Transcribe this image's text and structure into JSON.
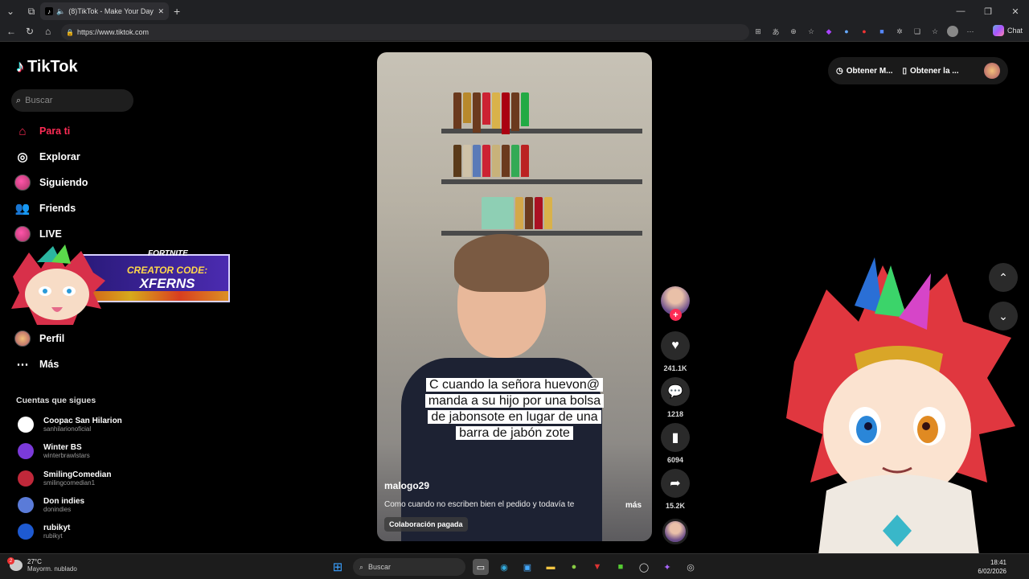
{
  "browser": {
    "tab_title": "(8)TikTok - Make Your Day",
    "url": "https://www.tiktok.com",
    "chat_label": "Chat"
  },
  "tiktok": {
    "logo": "TikTok",
    "search_placeholder": "Buscar",
    "menu": [
      {
        "label": "Para ti",
        "icon": "home-icon",
        "active": true
      },
      {
        "label": "Explorar",
        "icon": "compass-icon"
      },
      {
        "label": "Siguiendo",
        "icon": "following-avatar-icon"
      },
      {
        "label": "Friends",
        "icon": "friends-icon"
      },
      {
        "label": "LIVE",
        "icon": "live-avatar-icon"
      },
      {
        "label": "Perfil",
        "icon": "profile-avatar-icon"
      },
      {
        "label": "Más",
        "icon": "more-icon"
      }
    ],
    "following_title": "Cuentas que sigues",
    "following": [
      {
        "name": "Coopac San Hilarion",
        "handle": "sanhilarionoficial",
        "color": "#ffffff"
      },
      {
        "name": "Winter BS",
        "handle": "winterbrawlstars",
        "color": "#7b3ad9"
      },
      {
        "name": "SmilingComedian",
        "handle": "smilingcomedian1",
        "color": "#c0283a"
      },
      {
        "name": "Don indies",
        "handle": "donindies",
        "color": "#5a7bd8"
      },
      {
        "name": "rubikyt",
        "handle": "rubikyt",
        "color": "#1e5ad1"
      }
    ]
  },
  "overlay": {
    "fortnite": "FORTNITE",
    "creator_code_label": "CREATOR CODE:",
    "creator_code": "XFERNS"
  },
  "video": {
    "caption_lines": [
      "C cuando la señora huevon@",
      "manda a su hijo por una bolsa",
      "de jabonsote en lugar de una",
      "barra de jabón zote"
    ],
    "username": "malogo29",
    "description": "Como cuando no escriben bien el pedido y todavía te",
    "more": "más",
    "collab": "Colaboración pagada"
  },
  "actions": {
    "likes": "241.1K",
    "comments": "1218",
    "saves": "6094",
    "shares": "15.2K"
  },
  "top_buttons": {
    "get_app_1": "Obtener M...",
    "get_app_2": "Obtener la ..."
  },
  "taskbar": {
    "temp": "27°C",
    "weather": "Mayorm. nublado",
    "weather_badge": "2",
    "search": "Buscar",
    "time": "18:41",
    "date": "6/02/2026"
  }
}
